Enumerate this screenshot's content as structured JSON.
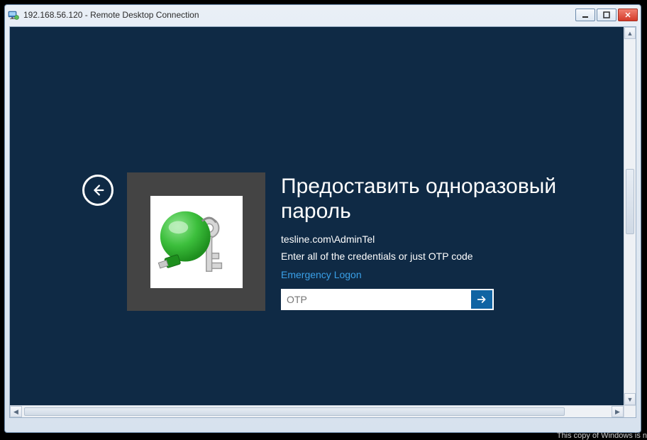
{
  "window": {
    "title": "192.168.56.120 - Remote Desktop Connection"
  },
  "login": {
    "heading": "Предоставить одноразовый пароль",
    "username": "tesline.com\\AdminTel",
    "instruction": "Enter all of the credentials or just OTP code",
    "emergency_label": "Emergency Logon",
    "otp_placeholder": "OTP",
    "otp_value": ""
  },
  "watermark": "This copy of Windows is n"
}
